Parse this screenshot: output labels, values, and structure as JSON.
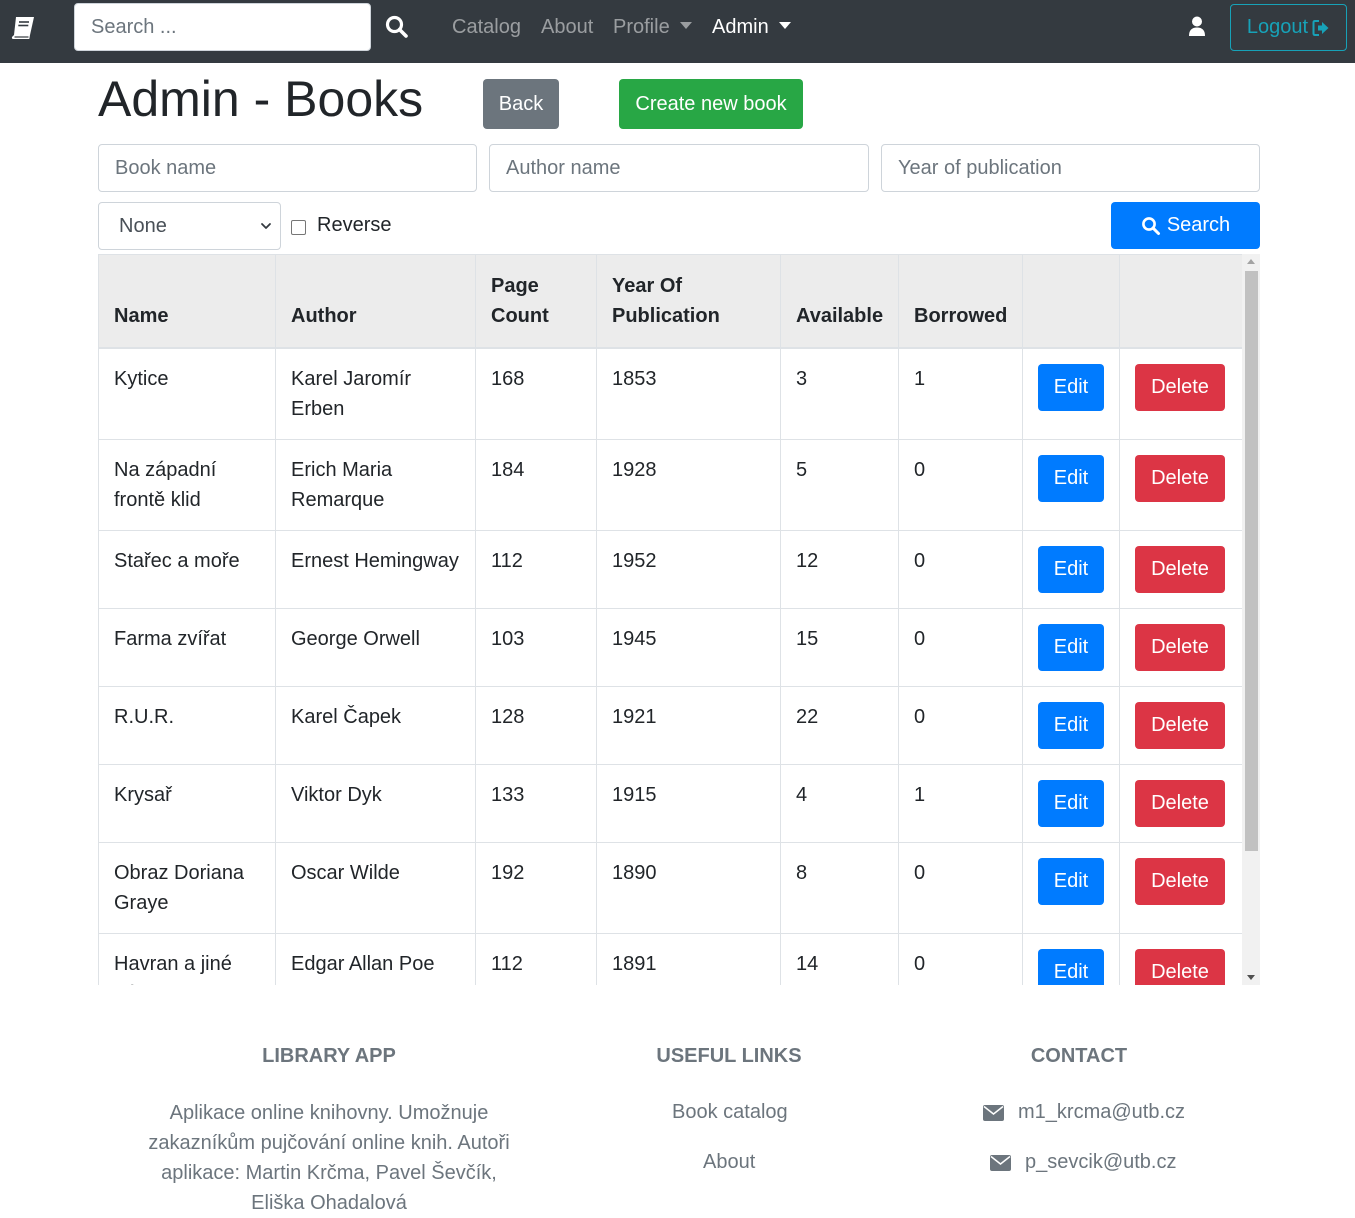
{
  "nav": {
    "search_placeholder": "Search ...",
    "links": [
      "Catalog",
      "About",
      "Profile",
      "Admin"
    ],
    "logout_label": "Logout"
  },
  "page": {
    "title": "Admin - Books",
    "back_label": "Back",
    "create_label": "Create new book"
  },
  "filters": {
    "book_name_placeholder": "Book name",
    "author_name_placeholder": "Author name",
    "year_placeholder": "Year of publication",
    "sort_selected": "None",
    "reverse_label": "Reverse",
    "search_label": "Search"
  },
  "table": {
    "headers": [
      "Name",
      "Author",
      "Page Count",
      "Year Of Publication",
      "Available",
      "Borrowed"
    ],
    "edit_label": "Edit",
    "delete_label": "Delete",
    "rows": [
      {
        "name": "Kytice",
        "author": "Karel Jaromír Erben",
        "pages": "168",
        "year": "1853",
        "available": "3",
        "borrowed": "1"
      },
      {
        "name": "Na západní frontě klid",
        "author": "Erich Maria Remarque",
        "pages": "184",
        "year": "1928",
        "available": "5",
        "borrowed": "0"
      },
      {
        "name": "Stařec a moře",
        "author": "Ernest Hemingway",
        "pages": "112",
        "year": "1952",
        "available": "12",
        "borrowed": "0"
      },
      {
        "name": "Farma zvířat",
        "author": "George Orwell",
        "pages": "103",
        "year": "1945",
        "available": "15",
        "borrowed": "0"
      },
      {
        "name": "R.U.R.",
        "author": "Karel Čapek",
        "pages": "128",
        "year": "1921",
        "available": "22",
        "borrowed": "0"
      },
      {
        "name": "Krysař",
        "author": "Viktor Dyk",
        "pages": "133",
        "year": "1915",
        "available": "4",
        "borrowed": "1"
      },
      {
        "name": "Obraz Doriana Graye",
        "author": "Oscar Wilde",
        "pages": "192",
        "year": "1890",
        "available": "8",
        "borrowed": "0"
      },
      {
        "name": "Havran a jiné básně",
        "author": "Edgar Allan Poe",
        "pages": "112",
        "year": "1891",
        "available": "14",
        "borrowed": "0"
      }
    ]
  },
  "footer": {
    "app_heading": "Library app",
    "app_text": "Aplikace online knihovny. Umožnuje zakazníkům pujčování online knih. Autoři aplikace: Martin Krčma, Pavel Ševčík, Eliška Ohadalová",
    "links_heading": "Useful links",
    "links": [
      "Book catalog",
      "About"
    ],
    "contact_heading": "Contact",
    "emails": [
      "m1_krcma@utb.cz",
      "p_sevcik@utb.cz"
    ]
  },
  "colors": {
    "navbar": "#343a40",
    "primary": "#007bff",
    "success": "#28a745",
    "secondary": "#6c757d",
    "danger": "#dc3545",
    "info": "#17a2b8"
  }
}
